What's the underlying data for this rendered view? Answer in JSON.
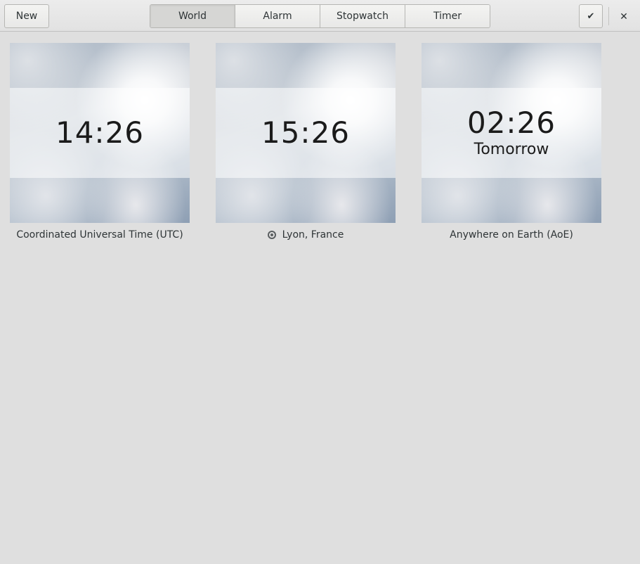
{
  "header": {
    "new_label": "New",
    "tabs": [
      {
        "label": "World",
        "active": true
      },
      {
        "label": "Alarm",
        "active": false
      },
      {
        "label": "Stopwatch",
        "active": false
      },
      {
        "label": "Timer",
        "active": false
      }
    ],
    "check_icon": "✔",
    "close_icon": "✕"
  },
  "clocks": [
    {
      "time": "14:26",
      "day": "",
      "location": "Coordinated Universal Time (UTC)",
      "current_location": false
    },
    {
      "time": "15:26",
      "day": "",
      "location": "Lyon, France",
      "current_location": true
    },
    {
      "time": "02:26",
      "day": "Tomorrow",
      "location": "Anywhere on Earth (AoE)",
      "current_location": false
    }
  ],
  "colors": {
    "window_bg": "#dfdfdf",
    "text": "#2e3436"
  }
}
